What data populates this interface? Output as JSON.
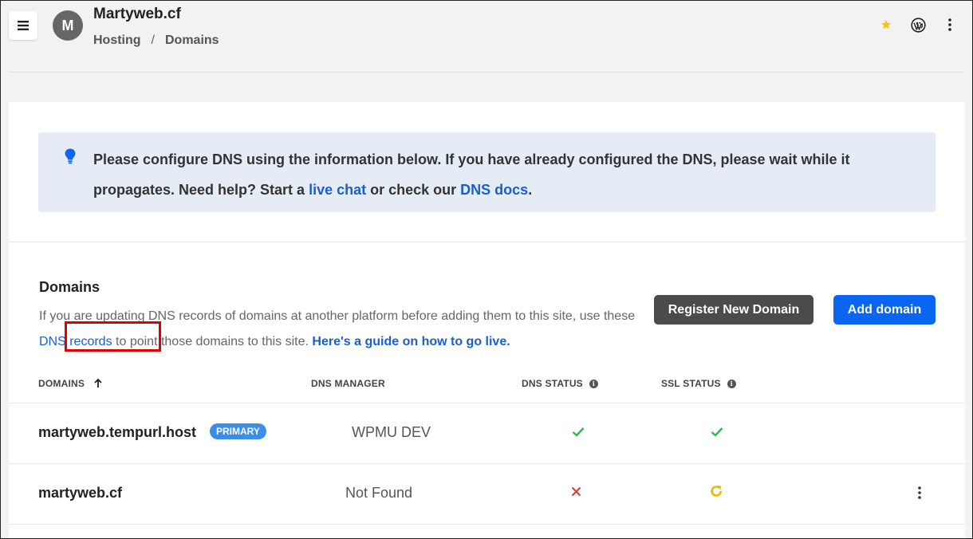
{
  "header": {
    "avatar_letter": "M",
    "site_title": "Martyweb.cf",
    "breadcrumb": [
      "Hosting",
      "Domains"
    ],
    "breadcrumb_separator": "/"
  },
  "notice": {
    "text_before": "Please configure DNS using the information below. If you have already configured the DNS, please wait while it propagates. Need help? Start a ",
    "live_chat_link": "live chat",
    "text_middle": " or check our ",
    "dns_docs_link": "DNS docs",
    "text_after": "."
  },
  "domains_section": {
    "heading": "Domains",
    "desc_before": "If you are updating DNS records of domains at another platform before adding them to this site, use these ",
    "dns_records_link": "DNS records",
    "desc_middle": " to point those domains to this site. ",
    "guide_link": "Here's a guide on how to go live.",
    "register_button": "Register New Domain",
    "add_button": "Add domain"
  },
  "table": {
    "columns": [
      "DOMAINS",
      "DNS MANAGER",
      "DNS STATUS",
      "SSL STATUS"
    ],
    "rows": [
      {
        "domain": "martyweb.tempurl.host",
        "badge": "PRIMARY",
        "dns_manager": "WPMU DEV",
        "dns_status": "ok",
        "ssl_status": "ok"
      },
      {
        "domain": "martyweb.cf",
        "badge": "",
        "dns_manager": "Not Found",
        "dns_status": "error",
        "ssl_status": "pending"
      }
    ]
  },
  "colors": {
    "link": "#1a5fd0",
    "primary_button": "#0a66f0",
    "secondary_button": "#4b4b4b",
    "badge": "#3a8ee8",
    "success": "#2db84d",
    "error": "#e53935",
    "pending": "#f2b600",
    "star": "#f5c518",
    "highlight": "#e00000"
  }
}
